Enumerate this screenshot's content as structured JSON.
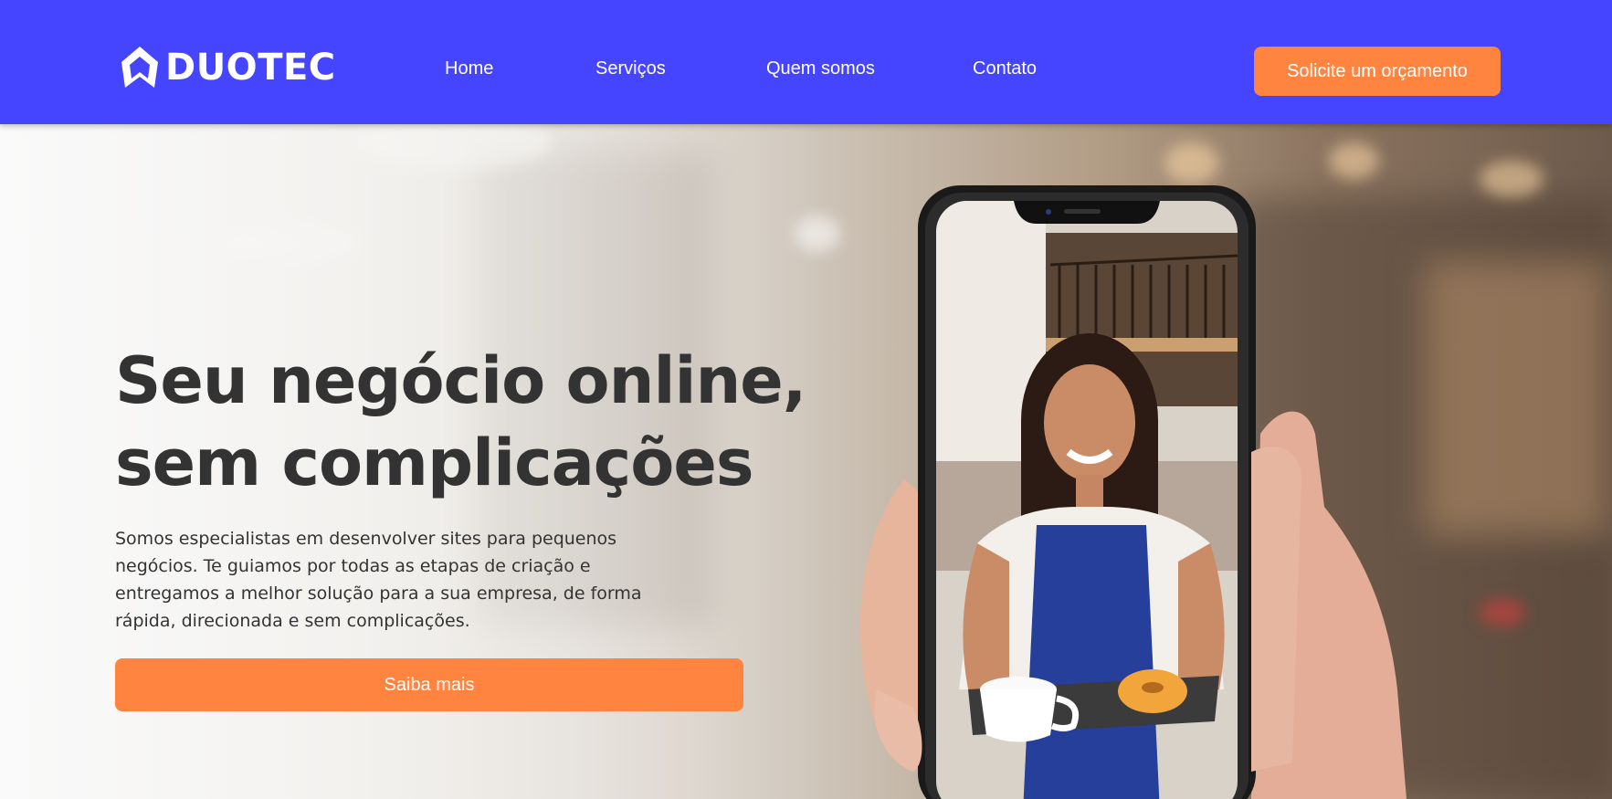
{
  "header": {
    "logo_text": "DUOTEC",
    "logo_icon": "house-shape-logo-icon",
    "nav": [
      {
        "label": "Home"
      },
      {
        "label": "Serviços"
      },
      {
        "label": "Quem somos"
      },
      {
        "label": "Contato"
      }
    ],
    "cta_label": "Solicite um orçamento"
  },
  "hero": {
    "headline_line1": "Seu negócio online,",
    "headline_line2": "sem complicações",
    "description": "Somos especialistas em desenvolver sites para pequenos negócios. Te guiamos por todas as etapas de criação e entregamos a melhor solução para a sua empresa, de forma rápida, direcionada e sem complicações.",
    "cta_label": "Saiba mais",
    "image": "hand-holding-smartphone-with-smiling-barista-image"
  },
  "colors": {
    "header_bg": "#4545ff",
    "accent": "#ff8440",
    "text_dark": "#333333",
    "white": "#ffffff"
  }
}
